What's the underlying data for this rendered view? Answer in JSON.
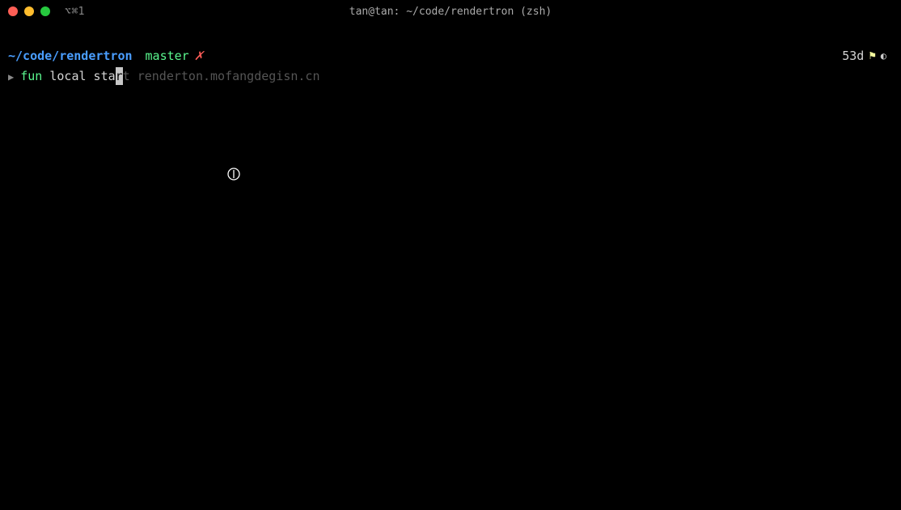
{
  "titlebar": {
    "tab_indicator": "⌥⌘1",
    "window_title": "tan@tan: ~/code/rendertron (zsh)"
  },
  "prompt": {
    "cwd": "~/code/rendertron",
    "branch": "master",
    "dirty_marker": "✗",
    "age": "53d"
  },
  "command": {
    "prompt_symbol": "▶",
    "keyword": "fun",
    "typed_before_cursor": " local sta",
    "cursor_char": "r",
    "typed_after_cursor": "t",
    "suggestion": " renderton.mofangdegisn.cn"
  }
}
